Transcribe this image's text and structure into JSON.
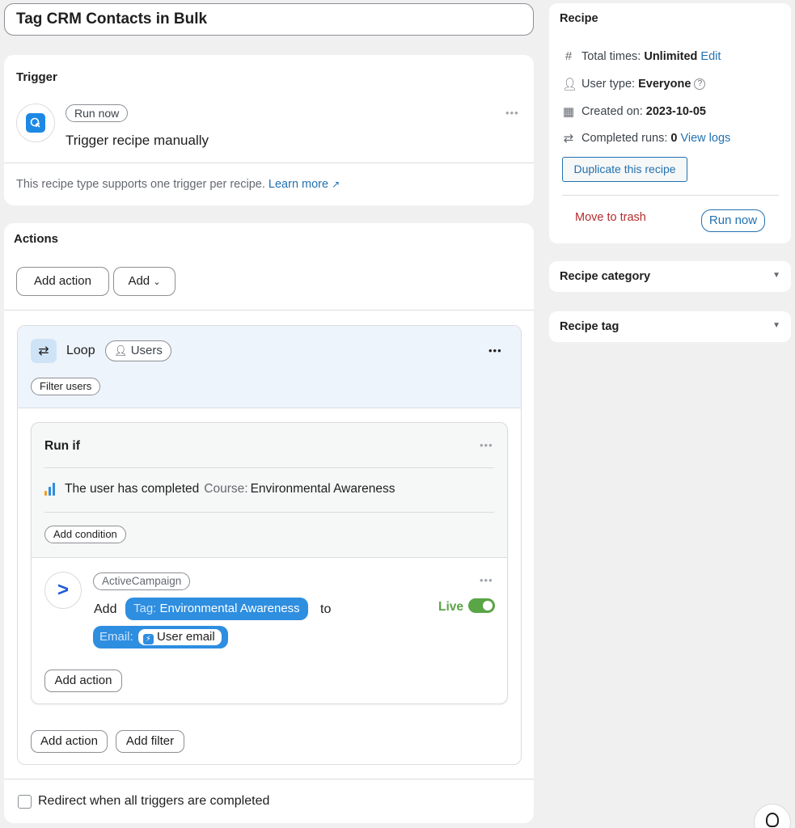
{
  "recipe_title": "Tag CRM Contacts in Bulk",
  "trigger": {
    "heading": "Trigger",
    "badge": "Run now",
    "description": "Trigger recipe manually",
    "note": "This recipe type supports one trigger per recipe.",
    "learn_more": "Learn more"
  },
  "actions": {
    "heading": "Actions",
    "add_action_label": "Add action",
    "add_label": "Add",
    "loop": {
      "label": "Loop",
      "target": "Users",
      "filter_button": "Filter users",
      "run_if": {
        "heading": "Run if",
        "condition_prefix": "The user has completed",
        "condition_field": "Course:",
        "condition_value": "Environmental Awareness",
        "add_condition": "Add condition"
      },
      "action_item": {
        "integration": "ActiveCampaign",
        "verb": "Add",
        "tag_label": "Tag:",
        "tag_value": "Environmental Awareness",
        "connector": "to",
        "email_label": "Email:",
        "email_value": "User email",
        "status": "Live",
        "status_color": "#5aa545",
        "add_action": "Add action"
      },
      "add_action": "Add action",
      "add_filter": "Add filter"
    },
    "redirect_label": "Redirect when all triggers are completed"
  },
  "sidebar": {
    "recipe": {
      "heading": "Recipe",
      "total_times_label": "Total times:",
      "total_times_value": "Unlimited",
      "edit_link": "Edit",
      "user_type_label": "User type:",
      "user_type_value": "Everyone",
      "created_label": "Created on:",
      "created_value": "2023-10-05",
      "completed_label": "Completed runs:",
      "completed_value": "0",
      "view_logs": "View logs",
      "duplicate_button": "Duplicate this recipe",
      "trash_link": "Move to trash",
      "run_now_button": "Run now"
    },
    "category": {
      "heading": "Recipe category"
    },
    "tag": {
      "heading": "Recipe tag"
    }
  },
  "colors": {
    "accent": "#2271b1",
    "token_blue": "#2e8ee0",
    "trash_red": "#b32d2e",
    "live_green": "#5aa545"
  }
}
